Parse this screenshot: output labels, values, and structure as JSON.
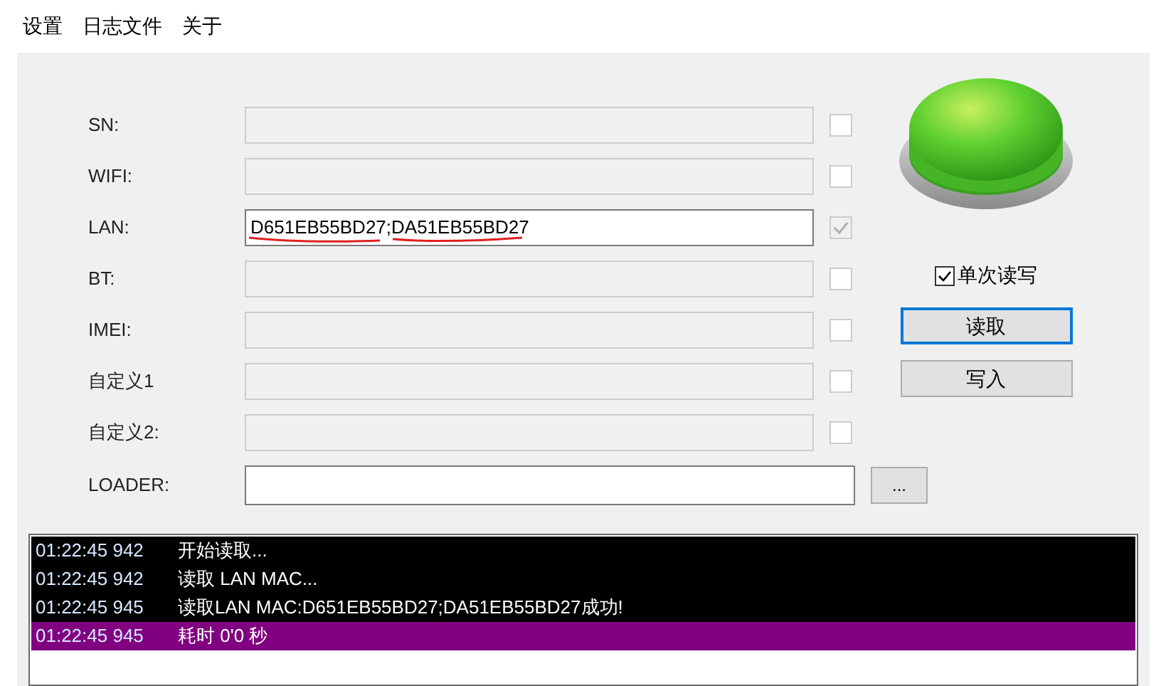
{
  "menu": [
    {
      "label": "设置"
    },
    {
      "label": "日志文件"
    },
    {
      "label": "关于"
    }
  ],
  "fields": [
    {
      "label": "SN:",
      "enabled": false,
      "checked": false,
      "checkbox_disabled": false
    },
    {
      "label": "WIFI:",
      "enabled": false,
      "checked": false,
      "checkbox_disabled": false
    },
    {
      "label": "LAN:",
      "value": "D651EB55BD27;DA51EB55BD27",
      "enabled": true,
      "checked": true,
      "checkbox_disabled": true,
      "underlined": true
    },
    {
      "label": "BT:",
      "enabled": false,
      "checked": false,
      "checkbox_disabled": false
    },
    {
      "label": "IMEI:",
      "enabled": false,
      "checked": false,
      "checkbox_disabled": false
    },
    {
      "label": "自定义1",
      "enabled": false,
      "checked": false,
      "checkbox_disabled": false
    },
    {
      "label": "自定义2:",
      "enabled": false,
      "checked": false,
      "checkbox_disabled": false
    }
  ],
  "loader": {
    "label": "LOADER:",
    "browse": "..."
  },
  "single_rw": {
    "label": "单次读写",
    "checked": true
  },
  "buttons": [
    {
      "label": "读取",
      "focused": true
    },
    {
      "label": "写入",
      "focused": false
    }
  ],
  "log": [
    {
      "time": "01:22:45 942",
      "message": "开始读取...",
      "selected": false
    },
    {
      "time": "01:22:45 942",
      "message": "读取 LAN MAC...",
      "selected": false
    },
    {
      "time": "01:22:45 945",
      "message": "读取LAN MAC:D651EB55BD27;DA51EB55BD27成功!",
      "selected": false
    },
    {
      "time": "01:22:45 945",
      "message": "耗时 0'0 秒",
      "selected": true
    }
  ]
}
